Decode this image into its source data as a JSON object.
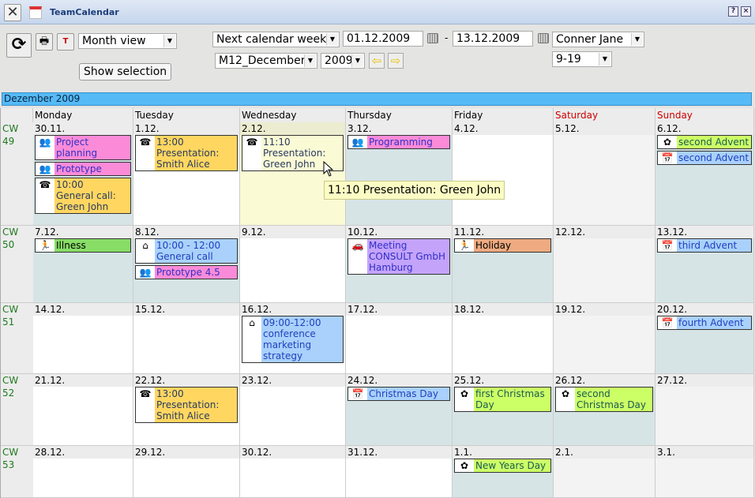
{
  "window": {
    "title": "TeamCalendar",
    "help": "?",
    "close": "×"
  },
  "toolbar": {
    "view": "Month view",
    "show_selection": "Show selection",
    "range": "Next calendar week",
    "date_from": "01.12.2009",
    "dash": "-",
    "date_to": "13.12.2009",
    "month": "M12_December",
    "year": "2009",
    "person": "Conner Jane",
    "hours": "9-19"
  },
  "month_label": "Dezember 2009",
  "weekdays": [
    "Monday",
    "Tuesday",
    "Wednesday",
    "Thursday",
    "Friday",
    "Saturday",
    "Sunday"
  ],
  "colors": {
    "weekend_header": "#cc0000",
    "cw": "#1e7a1e",
    "pink": "#fb8bd8",
    "orange": "#ffd660",
    "blue": "#a9d1fb",
    "purple": "#c4a3fb",
    "green": "#ccff66",
    "lightgreen": "#88dd66",
    "salmon": "#eeaa80",
    "teal": "#d6e4e6",
    "today": "#fafad4",
    "weekend": "#f3f3f3"
  },
  "weeks": [
    {
      "cw": "CW 49",
      "days": [
        {
          "date": "30.11.",
          "bg": "teal",
          "events": [
            {
              "icon": "meeting-icon",
              "color": "pink",
              "text": "Project planning"
            },
            {
              "icon": "meeting-icon",
              "color": "pink",
              "text": "Prototype"
            },
            {
              "icon": "phone-icon",
              "color": "orange",
              "text": "10:00\nGeneral call:\nGreen John"
            }
          ]
        },
        {
          "date": "1.12.",
          "bg": "white",
          "events": [
            {
              "icon": "phone-icon",
              "color": "orange",
              "text": "13:00\nPresentation:\nSmith Alice"
            }
          ]
        },
        {
          "date": "2.12.",
          "bg": "today",
          "events": [
            {
              "icon": "phone-icon",
              "color": "today",
              "text": "11:10\nPresentation:\nGreen John"
            }
          ]
        },
        {
          "date": "3.12.",
          "bg": "teal",
          "events": [
            {
              "icon": "meeting-icon",
              "color": "pink",
              "text": "Programming"
            }
          ]
        },
        {
          "date": "4.12.",
          "bg": "white",
          "events": []
        },
        {
          "date": "5.12.",
          "bg": "weekend",
          "events": []
        },
        {
          "date": "6.12.",
          "bg": "teal",
          "events": [
            {
              "icon": "flower-icon",
              "color": "green",
              "text": "second Advent"
            },
            {
              "icon": "calendar-icon",
              "color": "blue",
              "text": "second Advent"
            }
          ]
        }
      ]
    },
    {
      "cw": "CW 50",
      "days": [
        {
          "date": "7.12.",
          "bg": "teal",
          "events": [
            {
              "icon": "running-person-icon",
              "color": "lightgreen",
              "text": "Illness"
            }
          ]
        },
        {
          "date": "8.12.",
          "bg": "teal",
          "events": [
            {
              "icon": "house-icon",
              "color": "blue",
              "text": "10:00 - 12:00\nGeneral call"
            },
            {
              "icon": "meeting-icon",
              "color": "pink",
              "text": "Prototype 4.5"
            }
          ]
        },
        {
          "date": "9.12.",
          "bg": "white",
          "events": []
        },
        {
          "date": "10.12.",
          "bg": "teal",
          "events": [
            {
              "icon": "car-icon",
              "color": "purple",
              "text": "Meeting\nCONSULT GmbH\nHamburg"
            }
          ]
        },
        {
          "date": "11.12.",
          "bg": "teal",
          "events": [
            {
              "icon": "running-person-icon",
              "color": "salmon",
              "text": "Holiday"
            }
          ]
        },
        {
          "date": "12.12.",
          "bg": "weekend",
          "events": []
        },
        {
          "date": "13.12.",
          "bg": "teal",
          "events": [
            {
              "icon": "calendar-icon",
              "color": "blue",
              "text": "third Advent"
            }
          ]
        }
      ]
    },
    {
      "cw": "CW 51",
      "days": [
        {
          "date": "14.12.",
          "bg": "white",
          "events": []
        },
        {
          "date": "15.12.",
          "bg": "white",
          "events": []
        },
        {
          "date": "16.12.",
          "bg": "white",
          "events": [
            {
              "icon": "house-icon",
              "color": "blue",
              "text": "09:00-12:00\nconference\nmarketing strategy"
            }
          ]
        },
        {
          "date": "17.12.",
          "bg": "white",
          "events": []
        },
        {
          "date": "18.12.",
          "bg": "white",
          "events": []
        },
        {
          "date": "19.12.",
          "bg": "weekend",
          "events": []
        },
        {
          "date": "20.12.",
          "bg": "teal",
          "events": [
            {
              "icon": "calendar-icon",
              "color": "blue",
              "text": "fourth Advent"
            }
          ]
        }
      ]
    },
    {
      "cw": "CW 52",
      "days": [
        {
          "date": "21.12.",
          "bg": "white",
          "events": []
        },
        {
          "date": "22.12.",
          "bg": "white",
          "events": [
            {
              "icon": "phone-icon",
              "color": "orange",
              "text": "13:00\nPresentation:\nSmith Alice"
            }
          ]
        },
        {
          "date": "23.12.",
          "bg": "white",
          "events": []
        },
        {
          "date": "24.12.",
          "bg": "teal",
          "events": [
            {
              "icon": "calendar-icon",
              "color": "blue",
              "text": "Christmas Day"
            }
          ]
        },
        {
          "date": "25.12.",
          "bg": "teal",
          "events": [
            {
              "icon": "flower-icon",
              "color": "green",
              "text": "first Christmas\nDay"
            }
          ]
        },
        {
          "date": "26.12.",
          "bg": "teal",
          "events": [
            {
              "icon": "flower-icon",
              "color": "green",
              "text": "second\nChristmas Day"
            }
          ]
        },
        {
          "date": "27.12.",
          "bg": "weekend",
          "events": []
        }
      ]
    },
    {
      "cw": "CW 53",
      "days": [
        {
          "date": "28.12.",
          "bg": "white",
          "events": []
        },
        {
          "date": "29.12.",
          "bg": "white",
          "events": []
        },
        {
          "date": "30.12.",
          "bg": "white",
          "events": []
        },
        {
          "date": "31.12.",
          "bg": "white",
          "events": []
        },
        {
          "date": "1.1.",
          "bg": "teal",
          "events": [
            {
              "icon": "flower-icon",
              "color": "green",
              "text": "New Years Day"
            }
          ]
        },
        {
          "date": "2.1.",
          "bg": "weekend",
          "events": []
        },
        {
          "date": "3.1.",
          "bg": "weekend",
          "events": []
        }
      ]
    }
  ],
  "tooltip": "11:10 Presentation: Green John"
}
